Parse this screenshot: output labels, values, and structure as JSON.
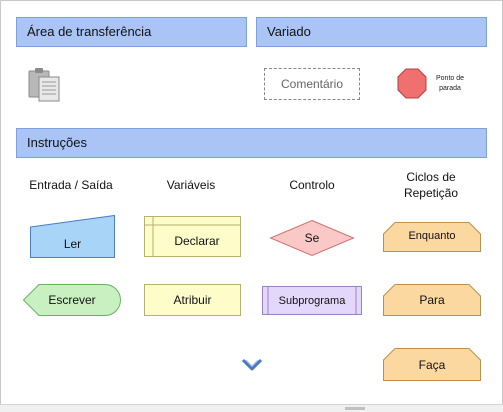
{
  "sections": {
    "clipboard": {
      "title": "Área de transferência"
    },
    "misc": {
      "title": "Variado"
    },
    "instructions": {
      "title": "Instruções"
    }
  },
  "misc_items": {
    "comment": "Comentário",
    "stop": "Ponto de parada"
  },
  "columns": {
    "io": "Entrada / Saída",
    "variables": "Variáveis",
    "control": "Controlo",
    "loops_line1": "Ciclos de",
    "loops_line2": "Repetição"
  },
  "shapes": {
    "read": "Ler",
    "write": "Escrever",
    "declare": "Declarar",
    "assign": "Atribuir",
    "if": "Se",
    "subprogram": "Subprograma",
    "while": "Enquanto",
    "for": "Para",
    "do": "Faça"
  },
  "icons": {
    "clipboard": "clipboard-icon",
    "scroll": "chevron-down-icon"
  },
  "colors": {
    "header_bg": "#a9c4f5",
    "io_fill": "#a8d4f8",
    "output_fill": "#c8f0c0",
    "var_fill": "#fefcc8",
    "decision_fill": "#fbc8c8",
    "subprogram_fill": "#e4d8fa",
    "loop_fill": "#fbd8a0",
    "stop_fill": "#f07070"
  }
}
